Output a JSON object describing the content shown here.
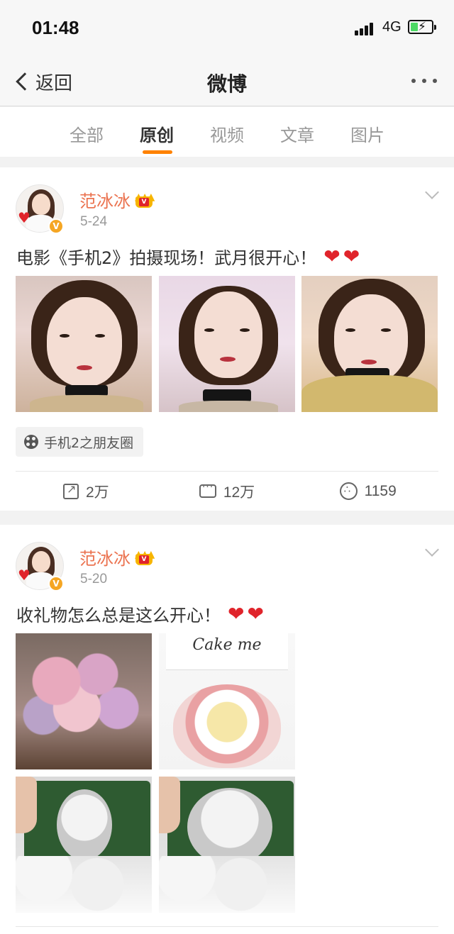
{
  "status_bar": {
    "time": "01:48",
    "network": "4G",
    "battery_level": 0.35
  },
  "nav": {
    "back_label": "返回",
    "title": "微博",
    "more_icon": "more-dots-icon"
  },
  "tabs": [
    {
      "label": "全部",
      "active": false
    },
    {
      "label": "原创",
      "active": true
    },
    {
      "label": "视频",
      "active": false
    },
    {
      "label": "文章",
      "active": false
    },
    {
      "label": "图片",
      "active": false
    }
  ],
  "posts": [
    {
      "author": "范冰冰",
      "date": "5-24",
      "text": "电影《手机2》拍摄现场！武月很开心！",
      "emoji": "❤❤",
      "topic": "手机2之朋友圈",
      "actions": {
        "share": "2万",
        "comment": "12万",
        "like": "1159"
      }
    },
    {
      "author": "范冰冰",
      "date": "5-20",
      "text": "收礼物怎么总是这么开心！",
      "emoji": "❤❤",
      "photo_text": {
        "cake_logo": "Cake me"
      }
    }
  ],
  "colors": {
    "accent": "#ff8200",
    "author": "#eb7350",
    "verified": "#f5a623",
    "heart": "#e0242b"
  }
}
